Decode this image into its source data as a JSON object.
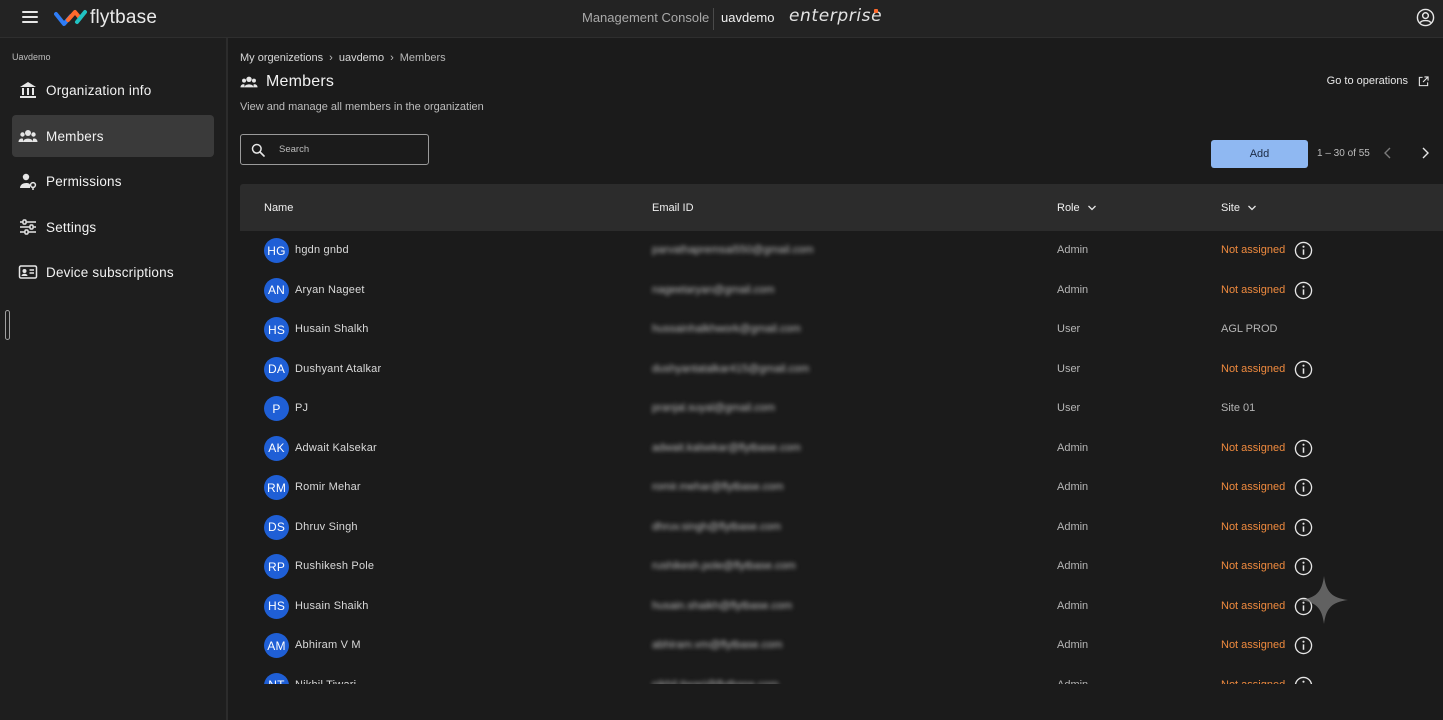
{
  "topbar": {
    "logo_text": "flytbase",
    "console_label": "Management Console",
    "org_name": "uavdemo",
    "plan_label": "enterprise"
  },
  "sidebar": {
    "org_label": "Uavdemo",
    "items": [
      {
        "label": "Organization info",
        "icon": "bank-icon",
        "active": false
      },
      {
        "label": "Members",
        "icon": "people-icon",
        "active": true
      },
      {
        "label": "Permissions",
        "icon": "user-key-icon",
        "active": false
      },
      {
        "label": "Settings",
        "icon": "sliders-icon",
        "active": false
      },
      {
        "label": "Device subscriptions",
        "icon": "id-card-icon",
        "active": false
      }
    ]
  },
  "main": {
    "breadcrumb": [
      "My orgenizetions",
      "uavdemo",
      "Members"
    ],
    "title": "Members",
    "subtitle": "View and manage all members in the organizatien",
    "go_to_ops": "Go to operations",
    "search_placeholder": "Search",
    "add_label": "Add",
    "pagination": "1 – 30 of 55"
  },
  "table": {
    "columns": {
      "name": "Name",
      "email": "Email ID",
      "role": "Role",
      "site": "Site"
    },
    "rows": [
      {
        "initials": "HG",
        "name": "hgdn gnbd",
        "email": "parvathapremsai550@gmail.com",
        "role": "Admin",
        "site": "Not assigned"
      },
      {
        "initials": "AN",
        "name": "Aryan Nageet",
        "email": "nageetaryan@gmail.com",
        "role": "Admin",
        "site": "Not assigned"
      },
      {
        "initials": "HS",
        "name": "Husain Shalkh",
        "email": "hussainhalkhwork@gmail.com",
        "role": "User",
        "site": "AGL PROD"
      },
      {
        "initials": "DA",
        "name": "Dushyant Atalkar",
        "email": "dushyantatalkar415@gmail.com",
        "role": "User",
        "site": "Not assigned"
      },
      {
        "initials": "P",
        "name": "PJ",
        "email": "pranjal.suyal@gmail.com",
        "role": "User",
        "site": "Site 01"
      },
      {
        "initials": "AK",
        "name": "Adwait Kalsekar",
        "email": "adwait.kalsekar@flytbase.com",
        "role": "Admin",
        "site": "Not assigned"
      },
      {
        "initials": "RM",
        "name": "Romir Mehar",
        "email": "romir.mehar@flytbase.com",
        "role": "Admin",
        "site": "Not assigned"
      },
      {
        "initials": "DS",
        "name": "Dhruv Singh",
        "email": "dhruv.singh@flytbase.com",
        "role": "Admin",
        "site": "Not assigned"
      },
      {
        "initials": "RP",
        "name": "Rushikesh Pole",
        "email": "rushikesh.pole@flytbase.com",
        "role": "Admin",
        "site": "Not assigned"
      },
      {
        "initials": "HS",
        "name": "Husain Shaikh",
        "email": "husain.shaikh@flytbase.com",
        "role": "Admin",
        "site": "Not assigned"
      },
      {
        "initials": "AM",
        "name": "Abhiram V M",
        "email": "abhiram.vm@flytbase.com",
        "role": "Admin",
        "site": "Not assigned"
      },
      {
        "initials": "NT",
        "name": "Nikhil Tiwari",
        "email": "nikhil.tiwari@flytbase.com",
        "role": "Admin",
        "site": "Not assigned"
      }
    ]
  },
  "colors": {
    "accent_button": "#8fb8f2",
    "avatar_bg": "#1f5fd6",
    "not_assigned": "#ef8a3e",
    "brand_orange": "#ff6a2c"
  }
}
